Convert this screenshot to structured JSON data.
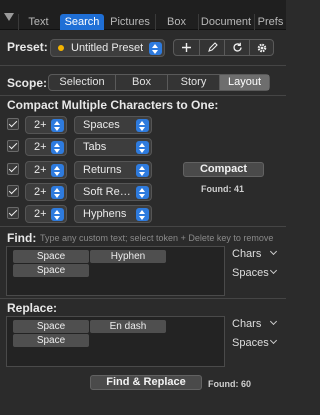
{
  "tabs": [
    {
      "label": "Text"
    },
    {
      "label": "Search",
      "active": true
    },
    {
      "label": "Pictures"
    },
    {
      "label": "Box"
    },
    {
      "label": "Document"
    },
    {
      "label": "Prefs"
    }
  ],
  "preset": {
    "label": "Preset:",
    "value": "Untitled Preset",
    "dot_color": "#f5b400"
  },
  "toolbar_icons": [
    "plus-icon",
    "pencil-icon",
    "refresh-icon",
    "gear-icon"
  ],
  "scope": {
    "label": "Scope:",
    "options": [
      "Selection",
      "Box",
      "Story",
      "Layout"
    ],
    "selected": "Layout"
  },
  "compact": {
    "heading": "Compact Multiple Characters to One:",
    "rows": [
      {
        "count": "2+",
        "type": "Spaces",
        "checked": true
      },
      {
        "count": "2+",
        "type": "Tabs",
        "checked": true
      },
      {
        "count": "2+",
        "type": "Returns",
        "checked": true
      },
      {
        "count": "2+",
        "type": "Soft Returns",
        "checked": true
      },
      {
        "count": "2+",
        "type": "Hyphens",
        "checked": true
      }
    ],
    "button": "Compact",
    "found": "Found: 41"
  },
  "find": {
    "label": "Find:",
    "hint": "Type any custom text; select token + Delete key to remove",
    "tokens": [
      "Space",
      "Hyphen",
      "Space"
    ],
    "chars_label": "Chars",
    "spaces_label": "Spaces"
  },
  "replace": {
    "label": "Replace:",
    "tokens": [
      "Space",
      "En dash",
      "Space"
    ],
    "chars_label": "Chars",
    "spaces_label": "Spaces"
  },
  "find_replace": {
    "button": "Find & Replace",
    "found": "Found: 60"
  },
  "colors": {
    "accent": "#1f6fd6",
    "background": "#2b2b2b"
  }
}
